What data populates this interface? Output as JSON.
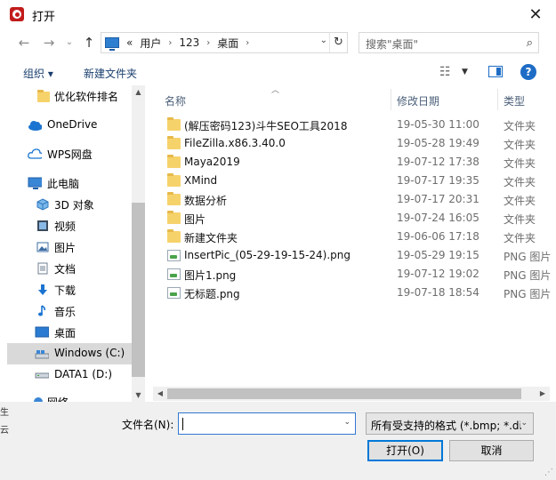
{
  "window": {
    "title": "打开",
    "close": "✕"
  },
  "nav": {
    "back": "←",
    "forward": "→",
    "recent_drop": "⌄",
    "up": "↑",
    "prefix": "«",
    "crumbs": [
      "用户",
      "123",
      "桌面"
    ],
    "sep": "›",
    "addr_drop": "⌄",
    "refresh": "↻",
    "search_placeholder": "搜索\"桌面\"",
    "search_icon": "⌕"
  },
  "toolbar": {
    "organize": "组织 ▾",
    "new_folder": "新建文件夹",
    "view_icon": "☷",
    "view_drop": "▼",
    "help": "?"
  },
  "sidebar": {
    "pin": "▲",
    "items": [
      {
        "label": "优化软件排名",
        "icon": "folder-icon"
      },
      {
        "label": "OneDrive",
        "icon": "cloud-icon"
      },
      {
        "label": "WPS网盘",
        "icon": "cloud-outline-icon"
      },
      {
        "label": "此电脑",
        "icon": "computer-icon"
      },
      {
        "label": "3D 对象",
        "icon": "cube-icon"
      },
      {
        "label": "视频",
        "icon": "video-icon"
      },
      {
        "label": "图片",
        "icon": "picture-icon"
      },
      {
        "label": "文档",
        "icon": "document-icon"
      },
      {
        "label": "下载",
        "icon": "download-icon"
      },
      {
        "label": "音乐",
        "icon": "music-icon"
      },
      {
        "label": "桌面",
        "icon": "desktop-icon"
      },
      {
        "label": "Windows (C:)",
        "icon": "drive-icon",
        "selected": true
      },
      {
        "label": "DATA1 (D:)",
        "icon": "drive-icon"
      },
      {
        "label": "网络",
        "icon": "network-icon"
      }
    ],
    "scroll_up": "▲",
    "scroll_down": "▼"
  },
  "list": {
    "columns": {
      "name": "名称",
      "date": "修改日期",
      "type": "类型"
    },
    "sort_caret": "︿",
    "rows": [
      {
        "name": "(解压密码123)斗牛SEO工具2018",
        "date": "19-05-30 11:00",
        "type": "文件夹",
        "kind": "folder"
      },
      {
        "name": "FileZilla.x86.3.40.0",
        "date": "19-05-28 19:49",
        "type": "文件夹",
        "kind": "folder"
      },
      {
        "name": "Maya2019",
        "date": "19-07-12 17:38",
        "type": "文件夹",
        "kind": "folder"
      },
      {
        "name": "XMind",
        "date": "19-07-17 19:35",
        "type": "文件夹",
        "kind": "folder"
      },
      {
        "name": "数据分析",
        "date": "19-07-17 20:31",
        "type": "文件夹",
        "kind": "folder"
      },
      {
        "name": "图片",
        "date": "19-07-24 16:05",
        "type": "文件夹",
        "kind": "folder"
      },
      {
        "name": "新建文件夹",
        "date": "19-06-06 17:18",
        "type": "文件夹",
        "kind": "folder"
      },
      {
        "name": "InsertPic_(05-29-19-15-24).png",
        "date": "19-05-29 19:15",
        "type": "PNG 图片",
        "kind": "file"
      },
      {
        "name": "图片1.png",
        "date": "19-07-12 19:02",
        "type": "PNG 图片",
        "kind": "file"
      },
      {
        "name": "无标题.png",
        "date": "19-07-18 18:54",
        "type": "PNG 图片",
        "kind": "file"
      }
    ],
    "scroll_left": "◀",
    "scroll_right": "▶"
  },
  "bottom": {
    "filename_label": "文件名(N):",
    "filename_value": "",
    "filename_drop": "⌄",
    "filter": "所有受支持的格式 (*.bmp; *.di",
    "filter_drop": "⌄",
    "open": "打开(O)",
    "cancel": "取消",
    "grip": "⋰"
  },
  "edge_text": [
    "生",
    "云"
  ]
}
